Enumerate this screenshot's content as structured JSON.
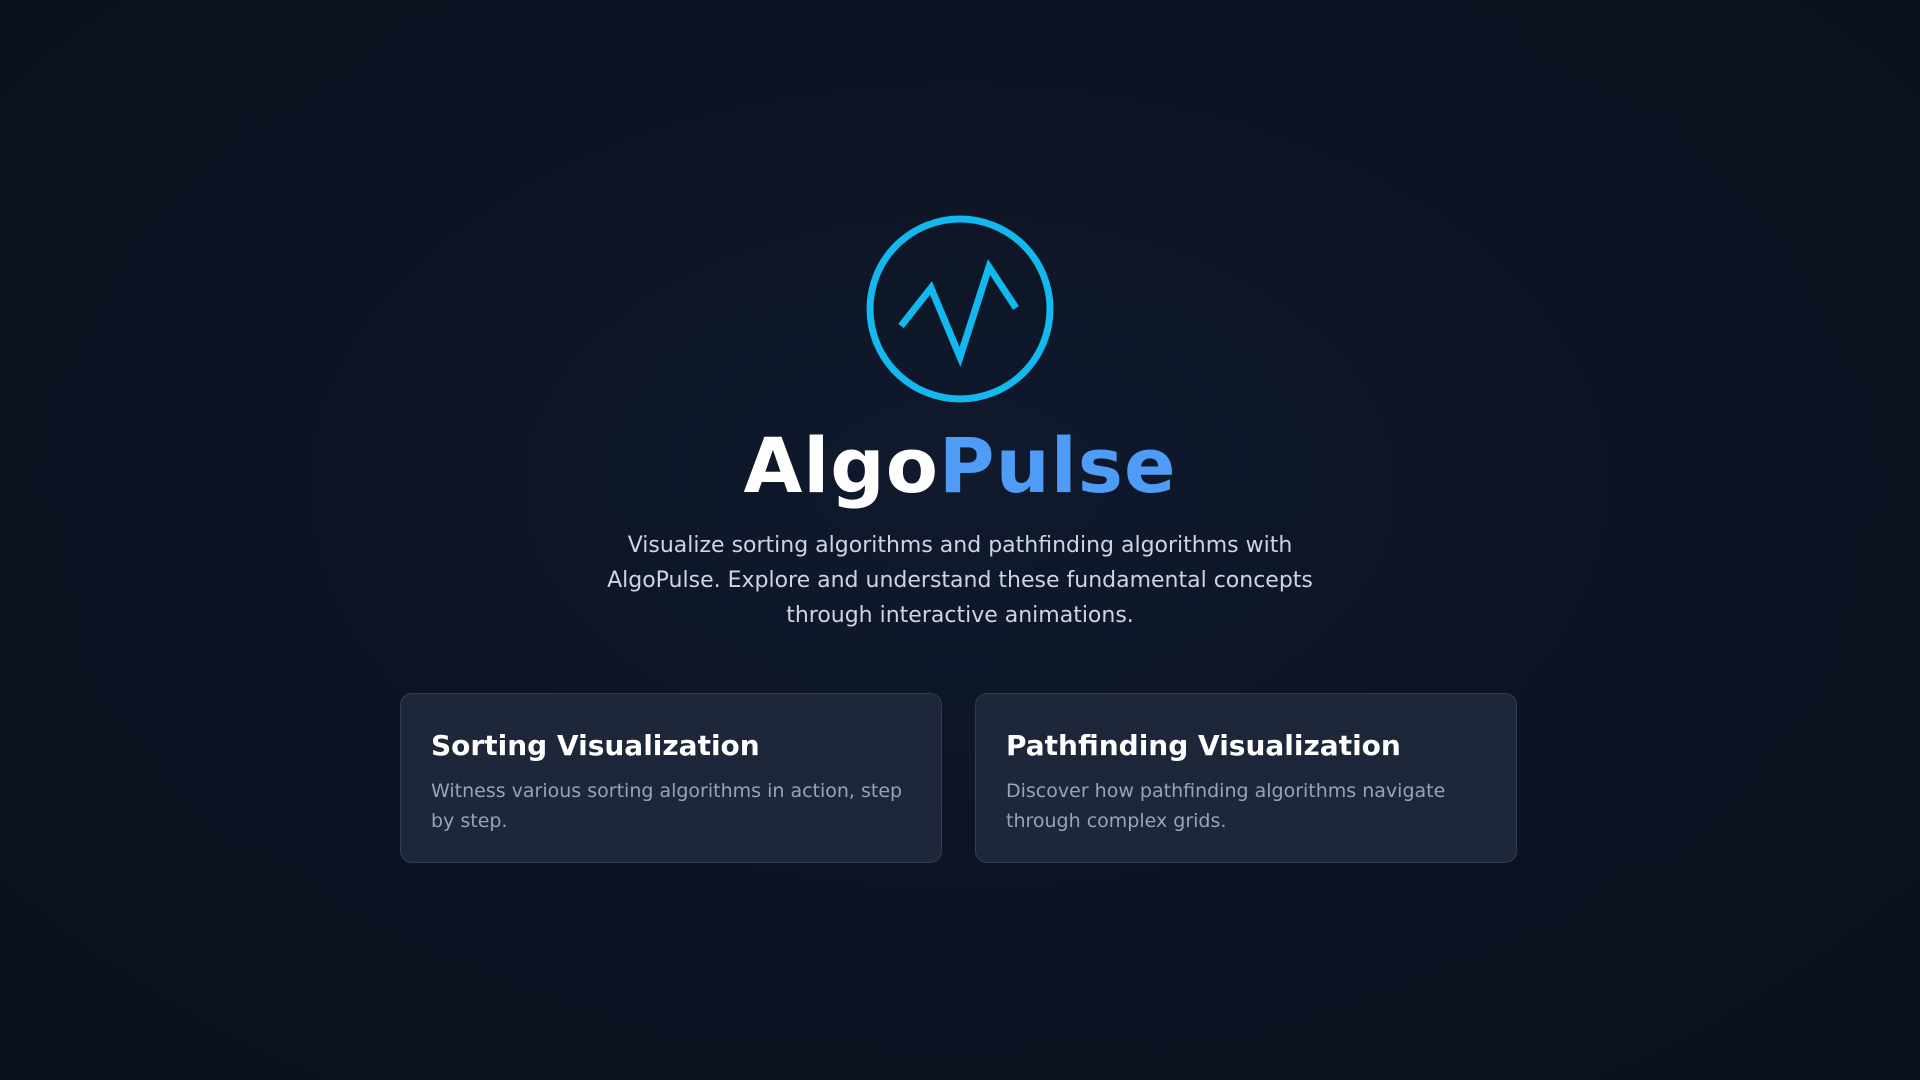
{
  "app": {
    "brand_part_1": "Algo",
    "brand_part_2": "Pulse",
    "logo_icon": "pulse-circle-icon",
    "tagline": "Visualize sorting algorithms and pathfinding algorithms with AlgoPulse. Explore and understand these fundamental concepts through interactive animations."
  },
  "cards": [
    {
      "title": "Sorting Visualization",
      "description": "Witness various sorting algorithms in action, step by step."
    },
    {
      "title": "Pathfinding Visualization",
      "description": "Discover how pathfinding algorithms navigate through complex grids."
    }
  ],
  "colors": {
    "background": "#0c1322",
    "accent_cyan": "#12b8ee",
    "accent_blue": "#4e9cf5",
    "card_background": "#1e2739",
    "card_border": "#323d52",
    "body_text": "#cdd5e2",
    "muted_text": "#97a3b6"
  }
}
